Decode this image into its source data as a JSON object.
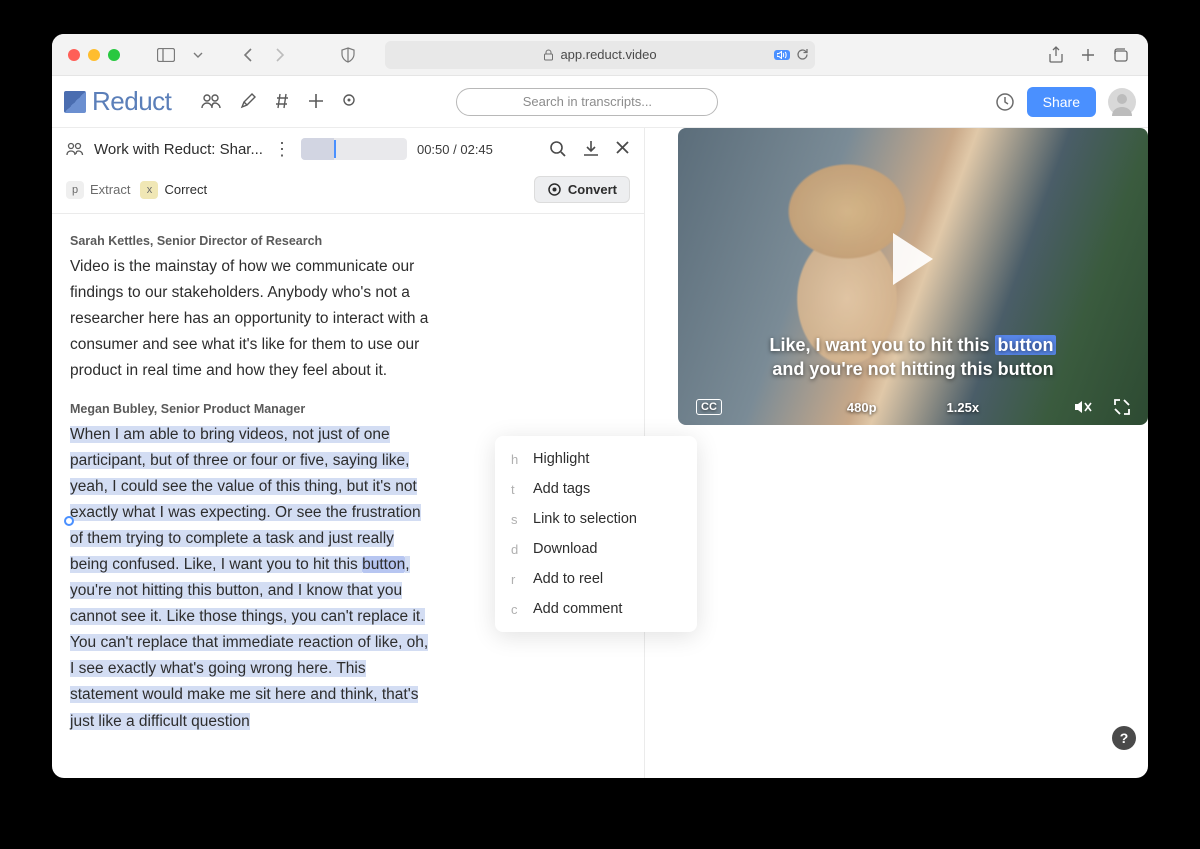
{
  "browser": {
    "url": "app.reduct.video"
  },
  "app": {
    "brand": "Reduct",
    "search_placeholder": "Search in transcripts...",
    "share_label": "Share"
  },
  "doc": {
    "title": "Work with Reduct:  Shar...",
    "time_current": "00:50",
    "time_total": "02:45",
    "extract_label": "Extract",
    "extract_key": "p",
    "correct_label": "Correct",
    "correct_key": "x",
    "convert_label": "Convert"
  },
  "transcript": {
    "speaker1": "Sarah Kettles, Senior Director of Research",
    "para1": "Video is the mainstay of how we communicate our findings to our stakeholders. Anybody who's not a researcher here has an opportunity to interact with a consumer and see what it's like for them to use our product in real time and how they feel about it.",
    "speaker2": "Megan Bubley, Senior Product Manager",
    "p2_a": "When I am able to bring videos, not just of one participant, but of three or four or five, saying like, yeah, I could see the value of this thing, but it's not exactly what I was expecting. Or see the frustration of them trying to complete a task and just really being confused. Like, I want you to hit this ",
    "p2_button": "button",
    "p2_b": ", you're not hitting this button, and I know that you cannot see it. Like those things, you can't replace it. You can't replace that immediate reaction of like, oh, I see exactly what's going wrong here. This statement would make me sit here and think, that's just like a difficult question"
  },
  "context_menu": [
    {
      "key": "h",
      "label": "Highlight"
    },
    {
      "key": "t",
      "label": "Add tags"
    },
    {
      "key": "s",
      "label": "Link to selection"
    },
    {
      "key": "d",
      "label": "Download"
    },
    {
      "key": "r",
      "label": "Add to reel"
    },
    {
      "key": "c",
      "label": "Add comment"
    }
  ],
  "video": {
    "caption_line1_a": "Like, I want you to hit this ",
    "caption_line1_b": "button",
    "caption_line2": "and you're not hitting this button",
    "cc": "CC",
    "quality": "480p",
    "speed": "1.25x"
  },
  "help": "?"
}
